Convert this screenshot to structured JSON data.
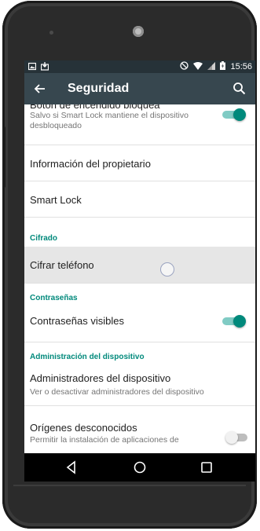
{
  "status_bar": {
    "time": "15:56",
    "left_icons": [
      "gallery-notification-icon",
      "download-notification-icon"
    ],
    "right_icons": [
      "do-not-disturb-icon",
      "wifi-icon",
      "signal-icon",
      "battery-icon"
    ]
  },
  "toolbar": {
    "title": "Seguridad",
    "back_icon": "arrow-back-icon",
    "search_icon": "search-icon"
  },
  "items": {
    "encendido": {
      "title": "Botón de encendido bloquea",
      "subtitle": "Salvo si Smart Lock mantiene el dispositivo desbloqueado",
      "switch_on": true
    },
    "propietario": {
      "title": "Información del propietario"
    },
    "smartlock": {
      "title": "Smart Lock"
    },
    "section_cifrado": "Cifrado",
    "cifrar": {
      "title": "Cifrar teléfono"
    },
    "section_contrasenas": "Contraseñas",
    "contrasenas_visibles": {
      "title": "Contraseñas visibles",
      "switch_on": true
    },
    "section_admin": "Administración del dispositivo",
    "administradores": {
      "title": "Administradores del dispositivo",
      "subtitle": "Ver o desactivar administradores del dispositivo"
    },
    "origenes": {
      "title": "Orígenes desconocidos",
      "subtitle": "Permitir la instalación de aplicaciones de",
      "switch_on": false
    }
  },
  "navbar": {
    "back_icon": "nav-back-icon",
    "home_icon": "nav-home-icon",
    "recents_icon": "nav-recents-icon"
  },
  "colors": {
    "status_bar": "#263238",
    "toolbar": "#37474f",
    "accent": "#00897b"
  }
}
